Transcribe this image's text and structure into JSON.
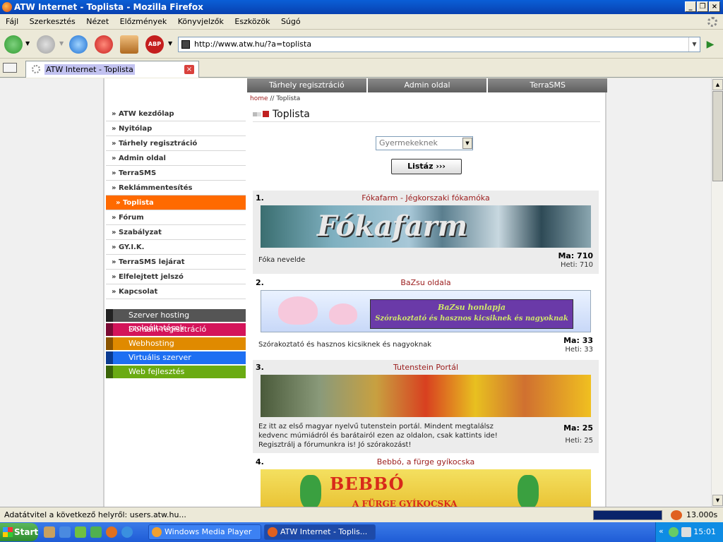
{
  "window": {
    "title": "ATW Internet - Toplista - Mozilla Firefox"
  },
  "menu": [
    "Fájl",
    "Szerkesztés",
    "Nézet",
    "Előzmények",
    "Könyvjelzők",
    "Eszközök",
    "Súgó"
  ],
  "urlbar": {
    "url": "http://www.atw.hu/?a=toplista"
  },
  "tab": {
    "label": "ATW Internet - Toplista"
  },
  "site": {
    "topnav": [
      "Tárhely regisztráció",
      "Admin oldal",
      "TerraSMS"
    ],
    "breadcrumb": {
      "home": "home",
      "sep": " // ",
      "current": "Toplista"
    },
    "leftnav": [
      "» ATW kezdőlap",
      "» Nyitólap",
      "» Tárhely regisztráció",
      "» Admin oldal",
      "» TerraSMS",
      "» Reklámmentesítés",
      "» Toplista",
      "» Fórum",
      "» Szabályzat",
      "» GY.I.K.",
      "» TerraSMS lejárat",
      "» Elfelejtett jelszó",
      "» Kapcsolat"
    ],
    "services": [
      {
        "label": "Szerver hosting szolgáltatások",
        "color": "#555555",
        "edge": "#222222"
      },
      {
        "label": "Domain regisztráció",
        "color": "#d4145a",
        "edge": "#7a0a34"
      },
      {
        "label": "Webhosting",
        "color": "#e08a00",
        "edge": "#8a5400"
      },
      {
        "label": "Virtuális szerver",
        "color": "#1e6ff2",
        "edge": "#0a3a90"
      },
      {
        "label": "Web fejlesztés",
        "color": "#6aab12",
        "edge": "#3a6408"
      }
    ],
    "page_title": "Toplista",
    "category_select": "Gyermekeknek",
    "list_button": "Listáz ›››",
    "entries": [
      {
        "rank": "1.",
        "name": "Fókafarm - Jégkorszaki fókamóka",
        "banner_text": "Fókafarm",
        "desc": "Fóka nevelde",
        "ma": "Ma: 710",
        "heti": "Heti: 710"
      },
      {
        "rank": "2.",
        "name": "BaZsu oldala",
        "banner_text": "BaZsu honlapja",
        "banner_sub": "Szórakoztató és hasznos kicsiknek és nagyoknak",
        "desc": "Szórakoztató és hasznos kicsiknek és nagyoknak",
        "ma": "Ma: 33",
        "heti": "Heti: 33"
      },
      {
        "rank": "3.",
        "name": "Tutenstein Portál",
        "desc": "Ez itt az első magyar nyelvű tutenstein portál. Mindent megtalálsz kedvenc múmiádról és barátairól ezen az oldalon, csak kattints ide! Regisztrálj a fórumunkra is! Jó szórakozást!",
        "ma": "Ma: 25",
        "heti": "Heti: 25"
      },
      {
        "rank": "4.",
        "name": "Bebbó, a fürge gyíkocska",
        "banner_text": "BEBBÓ",
        "banner_sub": "A FÜRGE GYÍKOCSKA"
      }
    ]
  },
  "statusbar": {
    "text": "Adatátvitel a következő helyről: users.atw.hu...",
    "time": "13.000s",
    "progress": 1.0
  },
  "taskbar": {
    "start": "Start",
    "items": [
      "Windows Media Player",
      "ATW Internet - Toplis..."
    ],
    "tray_arrow": "«",
    "clock": "15:01"
  }
}
